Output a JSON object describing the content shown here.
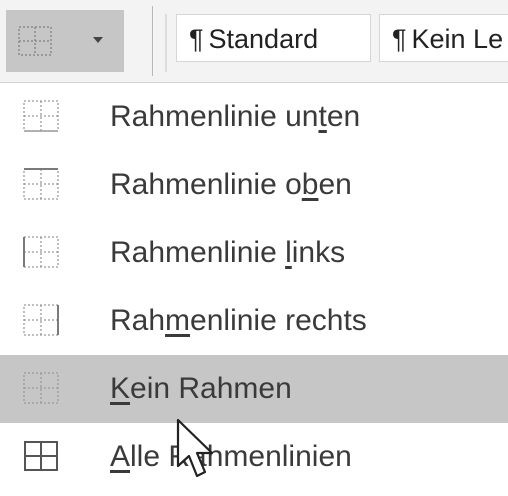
{
  "ribbon": {
    "borders_button_icon": "border-none-icon",
    "dropdown_icon": "chevron-down-icon",
    "styles": [
      {
        "pilcrow": "¶",
        "label": "Standard"
      },
      {
        "pilcrow": "¶",
        "label": "Kein Le"
      }
    ]
  },
  "menu": {
    "items": [
      {
        "icon": "border-bottom-icon",
        "pre": "Rahmenlinie un",
        "accel": "t",
        "post": "en",
        "selected": false
      },
      {
        "icon": "border-top-icon",
        "pre": "Rahmenlinie o",
        "accel": "b",
        "post": "en",
        "selected": false
      },
      {
        "icon": "border-left-icon",
        "pre": "Rahmenlinie ",
        "accel": "l",
        "post": "inks",
        "selected": false
      },
      {
        "icon": "border-right-icon",
        "pre": "Rah",
        "accel": "m",
        "post": "enlinie rechts",
        "selected": false
      },
      {
        "icon": "border-none-icon",
        "pre": "",
        "accel": "K",
        "post": "ein Rahmen",
        "selected": true
      },
      {
        "icon": "border-all-icon",
        "pre": "",
        "accel": "A",
        "post": "lle Rahmenlinien",
        "selected": false
      }
    ]
  },
  "colors": {
    "selection": "#c6c6c6",
    "ribbon_bg": "#f3f3f3",
    "text": "#3a3a3a"
  }
}
